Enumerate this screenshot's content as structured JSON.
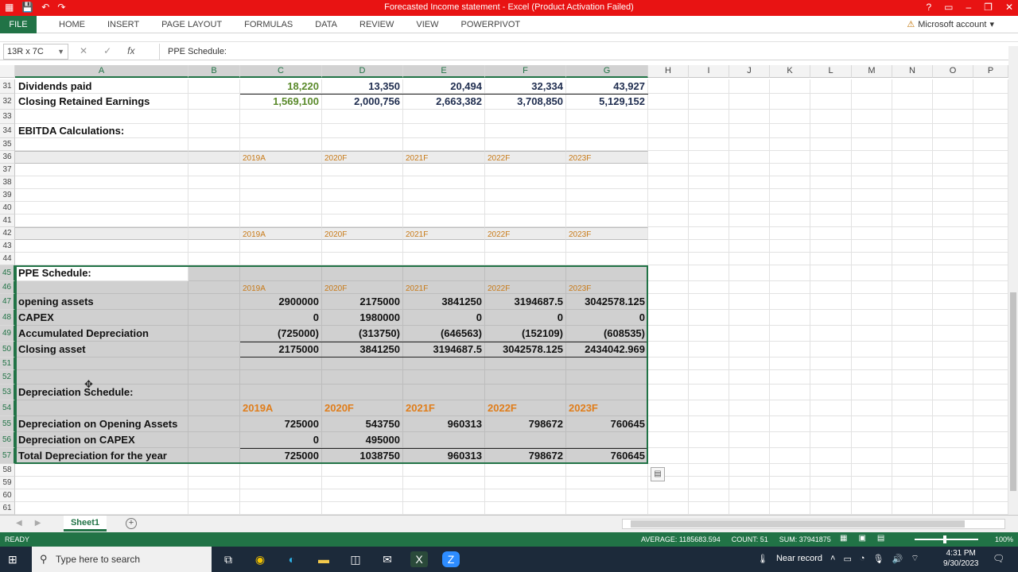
{
  "window": {
    "title": "Forecasted Income statement  -  Excel (Product Activation Failed)",
    "undo_icon": "undo-icon",
    "redo_icon": "redo-icon",
    "save_icon": "save-icon",
    "help_label": "?",
    "minimize_label": "–",
    "restore_label": "❐",
    "close_label": "✕"
  },
  "ribbon": {
    "file_label": "FILE",
    "tabs": [
      "HOME",
      "INSERT",
      "PAGE LAYOUT",
      "FORMULAS",
      "DATA",
      "REVIEW",
      "VIEW",
      "POWERPIVOT"
    ],
    "account_label": "Microsoft account"
  },
  "formula_bar": {
    "name_box": "13R x 7C",
    "fx_label": "fx",
    "cancel_label": "✕",
    "enter_label": "✓",
    "content": "PPE Schedule:"
  },
  "columns": [
    "A",
    "B",
    "C",
    "D",
    "E",
    "F",
    "G",
    "H",
    "I",
    "J",
    "K",
    "L",
    "M",
    "N",
    "O",
    "P"
  ],
  "rows": [
    {
      "n": "31",
      "a": "Dividends paid",
      "vals": [
        "18,220",
        "13,350",
        "20,494",
        "32,334",
        "43,927"
      ]
    },
    {
      "n": "32",
      "a": "Closing Retained Earnings",
      "vals": [
        "1,569,100",
        "2,000,756",
        "2,663,382",
        "3,708,850",
        "5,129,152"
      ]
    },
    {
      "n": "33"
    },
    {
      "n": "34",
      "a": "EBITDA Calculations:"
    },
    {
      "n": "35"
    },
    {
      "n": "36",
      "years": [
        "2019A",
        "2020F",
        "2021F",
        "2022F",
        "2023F"
      ]
    },
    {
      "n": "37"
    },
    {
      "n": "38"
    },
    {
      "n": "39"
    },
    {
      "n": "40"
    },
    {
      "n": "41"
    },
    {
      "n": "42",
      "years": [
        "2019A",
        "2020F",
        "2021F",
        "2022F",
        "2023F"
      ]
    },
    {
      "n": "43"
    },
    {
      "n": "44"
    },
    {
      "n": "45",
      "a": "PPE Schedule:"
    },
    {
      "n": "46",
      "years": [
        "2019A",
        "2020F",
        "2021F",
        "2022F",
        "2023F"
      ]
    },
    {
      "n": "47",
      "a": "opening assets",
      "vals": [
        "2900000",
        "2175000",
        "3841250",
        "3194687.5",
        "3042578.125"
      ]
    },
    {
      "n": "48",
      "a": "CAPEX",
      "vals": [
        "0",
        "1980000",
        "0",
        "0",
        "0"
      ]
    },
    {
      "n": "49",
      "a": "Accumulated Depreciation",
      "vals": [
        "(725000)",
        "(313750)",
        "(646563)",
        "(152109)",
        "(608535)"
      ]
    },
    {
      "n": "50",
      "a": "Closing asset",
      "vals": [
        "2175000",
        "3841250",
        "3194687.5",
        "3042578.125",
        "2434042.969"
      ]
    },
    {
      "n": "51"
    },
    {
      "n": "52"
    },
    {
      "n": "53",
      "a": "Depreciation Schedule:"
    },
    {
      "n": "54",
      "years": [
        "2019A",
        "2020F",
        "2021F",
        "2022F",
        "2023F"
      ]
    },
    {
      "n": "55",
      "a": "Depreciation on Opening Assets",
      "vals": [
        "725000",
        "543750",
        "960313",
        "798672",
        "760645"
      ]
    },
    {
      "n": "56",
      "a": "Depreciation on CAPEX",
      "vals": [
        "0",
        "495000",
        "",
        "",
        ""
      ]
    },
    {
      "n": "57",
      "a": "Total Depreciation for the year",
      "vals": [
        "725000",
        "1038750",
        "960313",
        "798672",
        "760645"
      ]
    },
    {
      "n": "58"
    },
    {
      "n": "59"
    },
    {
      "n": "60"
    },
    {
      "n": "61"
    }
  ],
  "sheet_tabs": {
    "active": "Sheet1",
    "add_label": "+"
  },
  "status_bar": {
    "ready": "READY",
    "average": "AVERAGE: 1185683.594",
    "count": "COUNT: 51",
    "sum": "SUM: 37941875",
    "zoom": "100%"
  },
  "taskbar": {
    "search_placeholder": "Type here to search",
    "weather": "Near record",
    "time": "4:31 PM",
    "date": "9/30/2023"
  }
}
